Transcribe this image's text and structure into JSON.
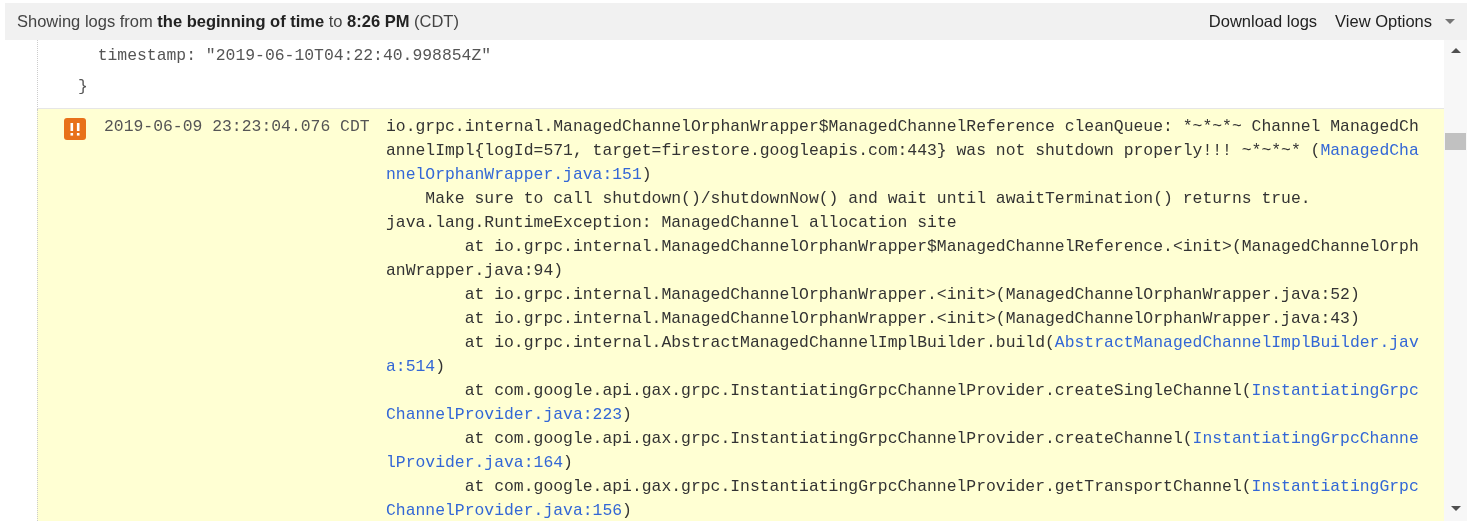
{
  "header": {
    "summary": "Showing logs from **the beginning of time** to **8:26 PM** (CDT)",
    "actions": [
      {
        "label": "Download logs",
        "kind": "link"
      },
      {
        "label": "View Options",
        "kind": "menu"
      }
    ]
  },
  "previous_entry": {
    "lines": [
      "  timestamp: \"2019-06-10T04:22:40.998854Z\"",
      "}"
    ]
  },
  "entries": [
    {
      "kind": "error",
      "timestamp": "2019-06-09 23:23:04.076 CDT",
      "lines": [
        [
          {
            "text": "io.grpc.internal.ManagedChannelOrphanWrapper$ManagedChannelReference cleanQueue: *~*~*~ Channel ManagedCh",
            "link": false
          }
        ],
        [
          {
            "text": "annelImpl{logId=571, target=firestore.googleapis.com:443} was not shutdown properly!!! ~*~*~* (",
            "link": false
          },
          {
            "text": "ManagedCha",
            "link": true
          }
        ],
        [
          {
            "text": "nnelOrphanWrapper.java:151",
            "link": true
          },
          {
            "text": ")",
            "link": false
          }
        ],
        [
          {
            "text": "    Make sure to call shutdown()/shutdownNow() and wait until awaitTermination() returns true.",
            "link": false
          }
        ],
        [
          {
            "text": "java.lang.RuntimeException: ManagedChannel allocation site",
            "link": false
          }
        ],
        [
          {
            "text": "        at io.grpc.internal.ManagedChannelOrphanWrapper$ManagedChannelReference.<init>(ManagedChannelOrph",
            "link": false
          }
        ],
        [
          {
            "text": "anWrapper.java:94)",
            "link": false
          }
        ],
        [
          {
            "text": "        at io.grpc.internal.ManagedChannelOrphanWrapper.<init>(ManagedChannelOrphanWrapper.java:52)",
            "link": false
          }
        ],
        [
          {
            "text": "        at io.grpc.internal.ManagedChannelOrphanWrapper.<init>(ManagedChannelOrphanWrapper.java:43)",
            "link": false
          }
        ],
        [
          {
            "text": "        at io.grpc.internal.AbstractManagedChannelImplBuilder.build(",
            "link": false
          },
          {
            "text": "AbstractManagedChannelImplBuilder.jav",
            "link": true
          }
        ],
        [
          {
            "text": "a:514",
            "link": true
          },
          {
            "text": ")",
            "link": false
          }
        ],
        [
          {
            "text": "        at com.google.api.gax.grpc.InstantiatingGrpcChannelProvider.createSingleChannel(",
            "link": false
          },
          {
            "text": "InstantiatingGrpc",
            "link": true
          }
        ],
        [
          {
            "text": "ChannelProvider.java:223",
            "link": true
          },
          {
            "text": ")",
            "link": false
          }
        ],
        [
          {
            "text": "        at com.google.api.gax.grpc.InstantiatingGrpcChannelProvider.createChannel(",
            "link": false
          },
          {
            "text": "InstantiatingGrpcChanne",
            "link": true
          }
        ],
        [
          {
            "text": "lProvider.java:164",
            "link": true
          },
          {
            "text": ")",
            "link": false
          }
        ],
        [
          {
            "text": "        at com.google.api.gax.grpc.InstantiatingGrpcChannelProvider.getTransportChannel(",
            "link": false
          },
          {
            "text": "InstantiatingGrpc",
            "link": true
          }
        ],
        [
          {
            "text": "ChannelProvider.java:156",
            "link": true
          },
          {
            "text": ")",
            "link": false
          }
        ]
      ]
    }
  ]
}
